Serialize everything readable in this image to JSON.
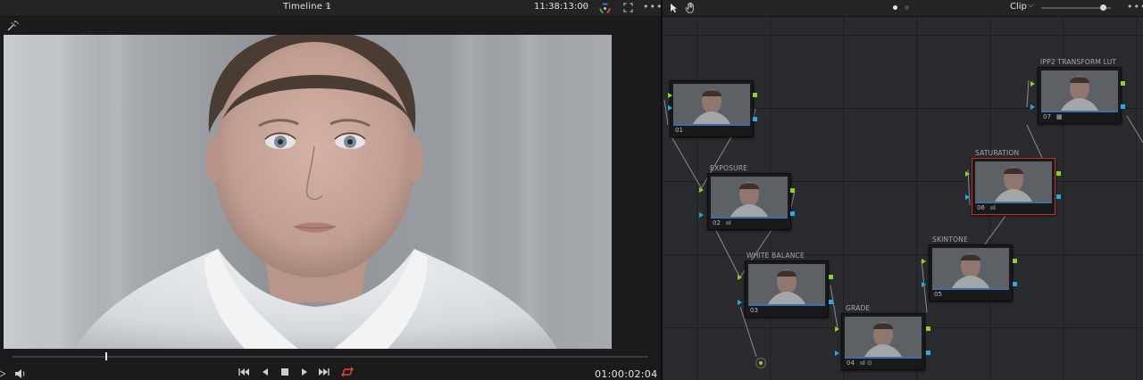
{
  "viewer": {
    "timeline_title": "Timeline 1",
    "timecode_top": "11:38:13:00",
    "timecode_bottom": "01:00:02:04",
    "playhead_fraction": 0.147,
    "icons": {
      "chevron": "chevron-down-icon",
      "color_wheel": "color-wheel-icon",
      "expand": "expand-icon",
      "more": "more-icon",
      "wand": "magic-wand-icon",
      "audio": "speaker-icon",
      "skip_back": "skip-to-start-icon",
      "step_back": "play-reverse-icon",
      "stop": "stop-icon",
      "play": "play-icon",
      "skip_fwd": "skip-to-end-icon",
      "loop": "loop-icon"
    },
    "loop_color": "#e8453c"
  },
  "node_editor": {
    "mode_label": "Clip",
    "zoom_fraction": 0.85,
    "icons": {
      "pointer": "pointer-icon",
      "hand": "hand-icon",
      "more": "more-icon"
    },
    "nodes": [
      {
        "id": "01",
        "label": "",
        "badges": "",
        "selected": false
      },
      {
        "id": "02",
        "label": "EXPOSURE",
        "badges": "ııl",
        "selected": false
      },
      {
        "id": "03",
        "label": "WHITE BALANCE",
        "badges": "",
        "selected": false
      },
      {
        "id": "04",
        "label": "GRADE",
        "badges": "ııl ⊙",
        "selected": false
      },
      {
        "id": "05",
        "label": "SKINTONE",
        "badges": "",
        "selected": false
      },
      {
        "id": "06",
        "label": "SATURATION",
        "badges": "ııl",
        "selected": true
      },
      {
        "id": "07",
        "label": "IPP2 TRANSFORM LUT",
        "badges": "▦",
        "selected": false
      }
    ],
    "colors": {
      "rgb_port": "#8fd12b",
      "alpha_port": "#27a9e6",
      "selected_border": "#c8302a"
    }
  }
}
